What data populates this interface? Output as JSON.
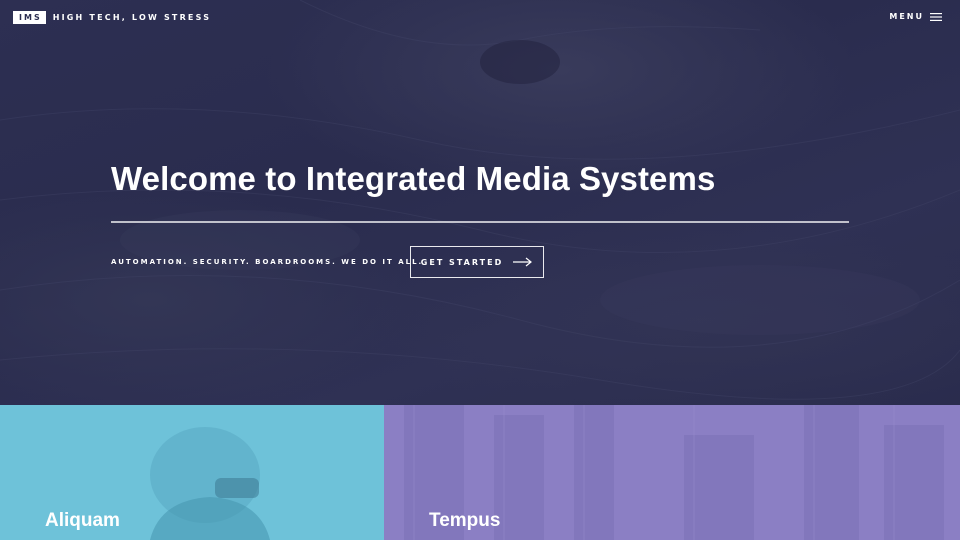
{
  "header": {
    "logo_text": "IMS",
    "tagline": "HIGH TECH, LOW STRESS",
    "menu_label": "MENU",
    "menu_icon": "hamburger-icon"
  },
  "banner": {
    "title": "Welcome to Integrated Media Systems",
    "subtitle": "AUTOMATION. SECURITY. BOARDROOMS. WE DO IT ALL.",
    "cta_label": "GET STARTED",
    "cta_icon": "arrow-right-icon"
  },
  "tiles": [
    {
      "title": "Aliquam",
      "color": "#6ec2d9"
    },
    {
      "title": "Tempus",
      "color": "#8b7fc4"
    }
  ],
  "colors": {
    "banner_bg": "#2a2c4f",
    "text": "#ffffff"
  }
}
